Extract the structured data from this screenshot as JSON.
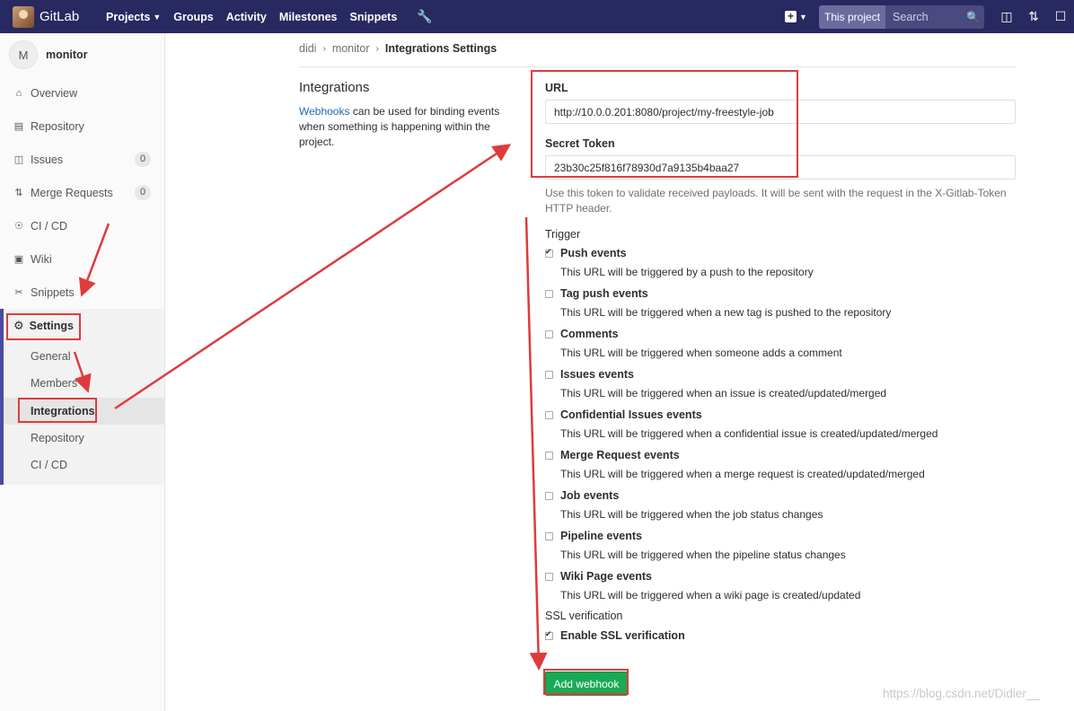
{
  "topbar": {
    "brand": "GitLab",
    "nav": [
      "Projects",
      "Groups",
      "Activity",
      "Milestones",
      "Snippets"
    ],
    "scope": "This project",
    "search_placeholder": "Search"
  },
  "sidebar": {
    "avatar_letter": "M",
    "project_name": "monitor",
    "items": [
      {
        "label": "Overview",
        "icon": "home-icon"
      },
      {
        "label": "Repository",
        "icon": "book-icon"
      },
      {
        "label": "Issues",
        "icon": "issues-icon",
        "count": "0"
      },
      {
        "label": "Merge Requests",
        "icon": "merge-request-icon",
        "count": "0"
      },
      {
        "label": "CI / CD",
        "icon": "rocket-icon"
      },
      {
        "label": "Wiki",
        "icon": "book-icon"
      },
      {
        "label": "Snippets",
        "icon": "scissors-icon"
      }
    ],
    "settings": {
      "label": "Settings",
      "subitems": [
        "General",
        "Members",
        "Integrations",
        "Repository",
        "CI / CD"
      ]
    }
  },
  "breadcrumb": [
    "didi",
    "monitor",
    "Integrations Settings"
  ],
  "integrations": {
    "title": "Integrations",
    "link": "Webhooks",
    "description": " can be used for binding events when something is happening within the project."
  },
  "form": {
    "url_label": "URL",
    "url_value": "http://10.0.0.201:8080/project/my-freestyle-job",
    "token_label": "Secret Token",
    "token_value": "23b30c25f816f78930d7a9135b4baa27",
    "token_help": "Use this token to validate received payloads. It will be sent with the request in the X-Gitlab-Token HTTP header.",
    "trigger_label": "Trigger",
    "triggers": [
      {
        "title": "Push events",
        "desc": "This URL will be triggered by a push to the repository",
        "checked": true
      },
      {
        "title": "Tag push events",
        "desc": "This URL will be triggered when a new tag is pushed to the repository",
        "checked": false
      },
      {
        "title": "Comments",
        "desc": "This URL will be triggered when someone adds a comment",
        "checked": false
      },
      {
        "title": "Issues events",
        "desc": "This URL will be triggered when an issue is created/updated/merged",
        "checked": false
      },
      {
        "title": "Confidential Issues events",
        "desc": "This URL will be triggered when a confidential issue is created/updated/merged",
        "checked": false
      },
      {
        "title": "Merge Request events",
        "desc": "This URL will be triggered when a merge request is created/updated/merged",
        "checked": false
      },
      {
        "title": "Job events",
        "desc": "This URL will be triggered when the job status changes",
        "checked": false
      },
      {
        "title": "Pipeline events",
        "desc": "This URL will be triggered when the pipeline status changes",
        "checked": false
      },
      {
        "title": "Wiki Page events",
        "desc": "This URL will be triggered when a wiki page is created/updated",
        "checked": false
      }
    ],
    "ssl_label": "SSL verification",
    "ssl_option": "Enable SSL verification",
    "submit": "Add webhook"
  },
  "watermark": "https://blog.csdn.net/Didier__",
  "colors": {
    "nav_bg": "#292961",
    "annotation": "#e03b3b",
    "submit": "#1aaa55",
    "link": "#1b69b6"
  }
}
